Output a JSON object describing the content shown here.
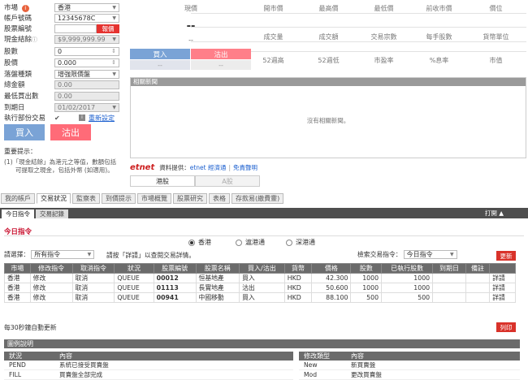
{
  "form": {
    "market": {
      "label": "市場",
      "value": "香港"
    },
    "account": {
      "label": "帳戶號碼",
      "value": "12345678C"
    },
    "stock_code": {
      "label": "股票編號",
      "value": "",
      "button": "報價"
    },
    "cash_balance": {
      "label": "現金結餘",
      "value": "$9,999,999.99"
    },
    "lots": {
      "label": "股數",
      "value": "0"
    },
    "price": {
      "label": "股價",
      "value": "0.000"
    },
    "order_type": {
      "label": "落盤種類",
      "value": "增強限價盤"
    },
    "total": {
      "label": "總金額",
      "value": "0.00"
    },
    "max_buy": {
      "label": "最低買出數",
      "value": "0.00"
    },
    "expiry": {
      "label": "到期日",
      "value": "01/02/2017"
    },
    "partial": {
      "label": "執行部份交易",
      "checkbox": "✔",
      "reset": "重新設定"
    },
    "buy_label": "買入",
    "sell_label": "沽出",
    "notes_title": "重要提示：",
    "notes": [
      "(1)「現金結餘」為港元之等值，數額包括",
      "可提取之現金，包括外幣 (如適用)。"
    ]
  },
  "quote": {
    "headers_row1": [
      "現價",
      "開市價",
      "最高價",
      "最低價",
      "前收市價",
      "價位"
    ],
    "current_price": "--",
    "dash_small": "--",
    "headers_row2": [
      "成交量",
      "成交額",
      "交易宗數",
      "每手股數",
      "貨幣單位"
    ],
    "headers_row3": [
      "52週高",
      "52週低",
      "市盈率",
      "%息率",
      "市值"
    ],
    "bid_label": "買入",
    "ask_label": "沽出",
    "bid_value": "--",
    "ask_value": "--"
  },
  "news": {
    "title": "相關新聞",
    "empty": "沒有相關新聞。",
    "source_brand": "etnet",
    "source_label": "資料提供：",
    "source_link": "etnet 經濟通",
    "disclaimer": "免責聲明"
  },
  "market_tabs": [
    "港股",
    "A股"
  ],
  "main_tabs": [
    "我的帳戶",
    "交易狀況",
    "監察表",
    "到價提示",
    "市場概覽",
    "股票研究",
    "表格",
    "存款易(繳費靈)"
  ],
  "sub_tabs": [
    "今日指令",
    "交易記錄"
  ],
  "open_toggle": "打開 ▲",
  "orders": {
    "title": "今日指令",
    "radios": [
      "香港",
      "滬港通",
      "深港通"
    ],
    "filter_label": "請選擇：",
    "filter_value": "所有指令",
    "hint": "請按「詳請」以查閱交易詳情。",
    "search_label": "檢索交易指令：",
    "search_value": "今日指令",
    "refresh": "更新",
    "columns": [
      "市場",
      "修改指令",
      "取消指令",
      "狀況",
      "股票編號",
      "股票名稱",
      "買入/沽出",
      "貨幣",
      "價格",
      "股數",
      "已執行股數",
      "到期日",
      "備註",
      ""
    ],
    "rows": [
      [
        "香港",
        "修改",
        "取消",
        "QUEUE",
        "00012",
        "恒基地產",
        "買入",
        "HKD",
        "42.300",
        "1000",
        "1000",
        "",
        "",
        "詳請"
      ],
      [
        "香港",
        "修改",
        "取消",
        "QUEUE",
        "01113",
        "長實地產",
        "沽出",
        "HKD",
        "50.600",
        "1000",
        "1000",
        "",
        "",
        "詳請"
      ],
      [
        "香港",
        "修改",
        "取消",
        "QUEUE",
        "00941",
        "中國移動",
        "買入",
        "HKD",
        "88.100",
        "500",
        "500",
        "",
        "",
        "詳請"
      ]
    ],
    "auto_refresh": "每30秒鐘自動更新",
    "print": "列印"
  },
  "legend": {
    "title": "圖例說明",
    "left_cols": [
      "狀況",
      "內容"
    ],
    "left_rows": [
      [
        "PEND",
        "系統已接受買賣盤"
      ],
      [
        "FILL",
        "買賣盤全部完成"
      ]
    ],
    "right_cols": [
      "修改類型",
      "內容"
    ],
    "right_rows": [
      [
        "New",
        "新買賣盤"
      ],
      [
        "Mod",
        "更改買賣盤"
      ]
    ]
  },
  "colors": {
    "blue": "#7aa3d6",
    "red": "#ff6b78",
    "dark": "#6b6b6b",
    "brand_red": "#cc1f1f"
  }
}
